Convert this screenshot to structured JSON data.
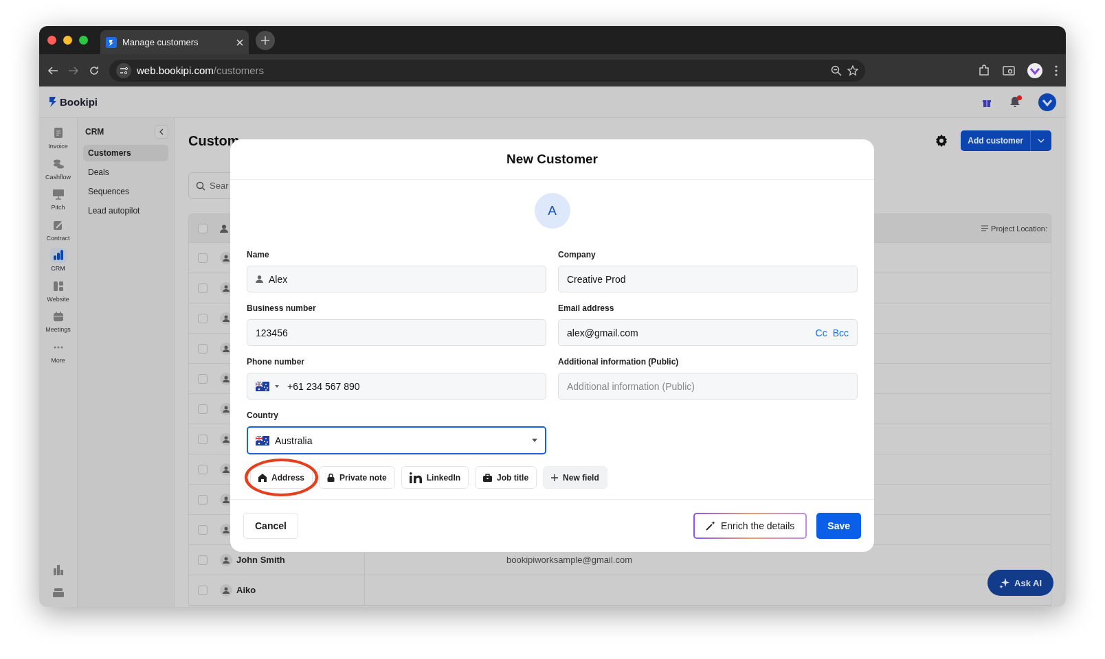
{
  "browser": {
    "tab_title": "Manage customers",
    "url_host": "web.bookipi.com",
    "url_path": "/customers"
  },
  "app": {
    "logo": "Bookipi",
    "notification_badge": true
  },
  "rail": [
    {
      "label": "Invoice",
      "selected": false
    },
    {
      "label": "Cashflow",
      "selected": false
    },
    {
      "label": "Pitch",
      "selected": false
    },
    {
      "label": "Contract",
      "selected": false
    },
    {
      "label": "CRM",
      "selected": true
    },
    {
      "label": "Website",
      "selected": false
    },
    {
      "label": "Meetings",
      "selected": false
    },
    {
      "label": "More",
      "selected": false
    }
  ],
  "submenu": {
    "title": "CRM",
    "items": [
      {
        "label": "Customers",
        "selected": true
      },
      {
        "label": "Deals",
        "selected": false
      },
      {
        "label": "Sequences",
        "selected": false
      },
      {
        "label": "Lead autopilot",
        "selected": false
      }
    ]
  },
  "page": {
    "title": "Custom",
    "search_placeholder": "Sear",
    "add_button": "Add customer",
    "table": {
      "column_4": "Project Location:",
      "header_checked": false,
      "rows": [
        {
          "checked": false
        },
        {
          "checked": false
        },
        {
          "checked": false
        },
        {
          "checked": false
        },
        {
          "checked": false
        },
        {
          "checked": false
        },
        {
          "checked": false
        },
        {
          "checked": false
        },
        {
          "checked": false
        },
        {
          "checked": false
        },
        {
          "checked": false,
          "name": "John Smith",
          "email": "bookipiworksample@gmail.com"
        },
        {
          "checked": false,
          "name": "Aiko"
        }
      ]
    }
  },
  "modal": {
    "title": "New Customer",
    "avatar": "A",
    "fields": [
      {
        "label": "Name",
        "kind": "person",
        "value": "Alex",
        "focused": false
      },
      {
        "label": "Company",
        "kind": "text",
        "value": "Creative Prod",
        "focused": false
      },
      {
        "label": "Business number",
        "kind": "text",
        "value": "123456",
        "focused": false
      },
      {
        "label": "Email address",
        "kind": "email",
        "value": "alex@gmail.com",
        "cc": "Cc",
        "bcc": "Bcc",
        "focused": false
      },
      {
        "label": "Phone number",
        "kind": "phone",
        "value": "+61 234 567 890",
        "focused": false
      },
      {
        "label": "Additional information (Public)",
        "kind": "text",
        "placeholder": "Additional information (Public)",
        "focused": false
      },
      {
        "label": "Country",
        "kind": "select",
        "value": "Australia",
        "focused": true
      }
    ],
    "chips": [
      {
        "label": "Address",
        "kind": "house",
        "highlighted": true
      },
      {
        "label": "Private note",
        "kind": "lock",
        "highlighted": false
      },
      {
        "label": "LinkedIn",
        "kind": "linkedin",
        "highlighted": false
      },
      {
        "label": "Job title",
        "kind": "briefcase",
        "highlighted": false
      },
      {
        "label": "New field",
        "kind": "add",
        "highlighted": false
      }
    ],
    "buttons": [
      {
        "label": "Cancel",
        "kind": "secondary"
      },
      {
        "label": "Enrich the details",
        "kind": "ai"
      },
      {
        "label": "Save",
        "kind": "primary"
      }
    ]
  },
  "ask_ai": "Ask AI"
}
